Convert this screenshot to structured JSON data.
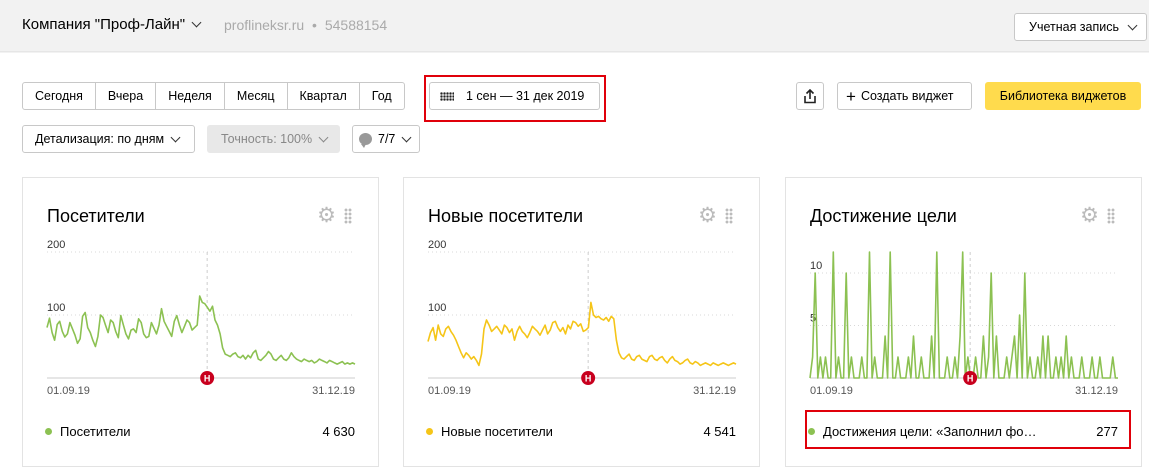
{
  "header": {
    "company": "Компания \"Проф-Лайн\"",
    "site": "proflineksr.ru",
    "separator": "•",
    "counter_id": "54588154",
    "account_label": "Учетная запись"
  },
  "period": {
    "buttons": [
      "Сегодня",
      "Вчера",
      "Неделя",
      "Месяц",
      "Квартал",
      "Год"
    ],
    "date_range": "1 сен — 31 дек 2019"
  },
  "toolbar": {
    "create_widget": "Создать виджет",
    "widget_library": "Библиотека виджетов"
  },
  "filters": {
    "detail": "Детализация: по дням",
    "accuracy": "Точность: 100%",
    "notes": "7/7"
  },
  "colors": {
    "visitors": "#8cc152",
    "new_visitors": "#f5c518",
    "goal": "#8cc152",
    "library_button": "#ffdb4d",
    "highlight": "#e0000a",
    "note_marker": "#c8001e"
  },
  "widgets": [
    {
      "title": "Посетители",
      "legend_label": "Посетители",
      "total": "4 630",
      "chart_data": {
        "type": "line",
        "x_start": "01.09.19",
        "x_end": "31.12.19",
        "y_ticks": [
          "200",
          "100"
        ],
        "ylim": [
          0,
          200
        ],
        "note_marker": "Н",
        "series": [
          {
            "values": [
              80,
              95,
              72,
              60,
              85,
              90,
              74,
              65,
              70,
              88,
              78,
              68,
              55,
              62,
              98,
              104,
              80,
              72,
              60,
              50,
              66,
              100,
              96,
              84,
              72,
              92,
              88,
              74,
              64,
              99,
              84,
              70,
              62,
              76,
              78,
              72,
              94,
              88,
              70,
              64,
              66,
              88,
              79,
              70,
              84,
              110,
              90,
              82,
              74,
              66,
              90,
              99,
              84,
              72,
              82,
              92,
              88,
              76,
              80,
              84,
              130,
              120,
              118,
              112,
              106,
              114,
              92,
              84,
              70,
              48,
              38,
              36,
              34,
              38,
              40,
              34,
              32,
              36,
              30,
              36,
              32,
              40,
              44,
              30,
              28,
              32,
              36,
              42,
              38,
              30,
              28,
              32,
              36,
              30,
              28,
              32,
              40,
              34,
              30,
              28,
              26,
              30,
              28,
              26,
              28,
              24,
              26,
              30,
              28,
              26,
              24,
              28,
              26,
              24,
              22,
              24,
              26,
              22,
              24,
              22,
              24,
              22
            ]
          }
        ]
      }
    },
    {
      "title": "Новые посетители",
      "legend_label": "Новые посетители",
      "total": "4 541",
      "chart_data": {
        "type": "line",
        "x_start": "01.09.19",
        "x_end": "31.12.19",
        "y_ticks": [
          "200",
          "100"
        ],
        "ylim": [
          0,
          200
        ],
        "note_marker": "Н",
        "series": [
          {
            "values": [
              58,
              72,
              80,
              60,
              84,
              70,
              66,
              78,
              82,
              74,
              68,
              60,
              50,
              40,
              32,
              40,
              36,
              30,
              34,
              28,
              20,
              38,
              78,
              92,
              84,
              74,
              78,
              82,
              76,
              70,
              84,
              80,
              72,
              78,
              60,
              74,
              82,
              74,
              70,
              64,
              72,
              82,
              78,
              74,
              68,
              76,
              84,
              70,
              76,
              88,
              90,
              80,
              74,
              80,
              70,
              84,
              78,
              90,
              88,
              82,
              86,
              74,
              76,
              80,
              120,
              100,
              96,
              98,
              94,
              92,
              96,
              90,
              98,
              94,
              60,
              40,
              32,
              30,
              34,
              38,
              30,
              28,
              34,
              36,
              30,
              28,
              26,
              34,
              36,
              30,
              28,
              32,
              34,
              28,
              24,
              30,
              34,
              28,
              26,
              22,
              24,
              28,
              30,
              24,
              22,
              26,
              24,
              20,
              22,
              24,
              22,
              20,
              24,
              22,
              20,
              22,
              24,
              22,
              20,
              22,
              24,
              22
            ]
          }
        ]
      }
    },
    {
      "title": "Достижение цели",
      "legend_label": "Достижения цели: «Заполнил фо…",
      "total": "277",
      "chart_data": {
        "type": "line",
        "x_start": "01.09.19",
        "x_end": "31.12.19",
        "y_ticks": [
          "10",
          "5"
        ],
        "ylim": [
          0,
          12
        ],
        "note_marker": "Н",
        "series": [
          {
            "values": [
              0,
              2,
              10,
              0,
              2,
              0,
              2,
              0,
              0,
              12,
              0,
              2,
              0,
              0,
              10,
              0,
              2,
              0,
              0,
              0,
              2,
              0,
              0,
              12,
              0,
              2,
              0,
              0,
              0,
              4,
              0,
              12,
              0,
              0,
              2,
              0,
              0,
              0,
              2,
              0,
              4,
              0,
              0,
              2,
              0,
              0,
              0,
              4,
              0,
              12,
              0,
              0,
              0,
              2,
              0,
              0,
              2,
              0,
              4,
              12,
              0,
              2,
              0,
              0,
              2,
              0,
              0,
              4,
              0,
              2,
              10,
              0,
              4,
              0,
              0,
              0,
              2,
              0,
              2,
              4,
              0,
              6,
              0,
              10,
              0,
              2,
              0,
              0,
              2,
              0,
              4,
              0,
              4,
              0,
              0,
              2,
              0,
              2,
              0,
              4,
              0,
              2,
              0,
              0,
              0,
              2,
              0,
              0,
              0,
              2,
              0,
              0,
              2,
              0,
              0,
              0,
              0,
              2,
              0,
              0
            ]
          }
        ]
      }
    }
  ]
}
